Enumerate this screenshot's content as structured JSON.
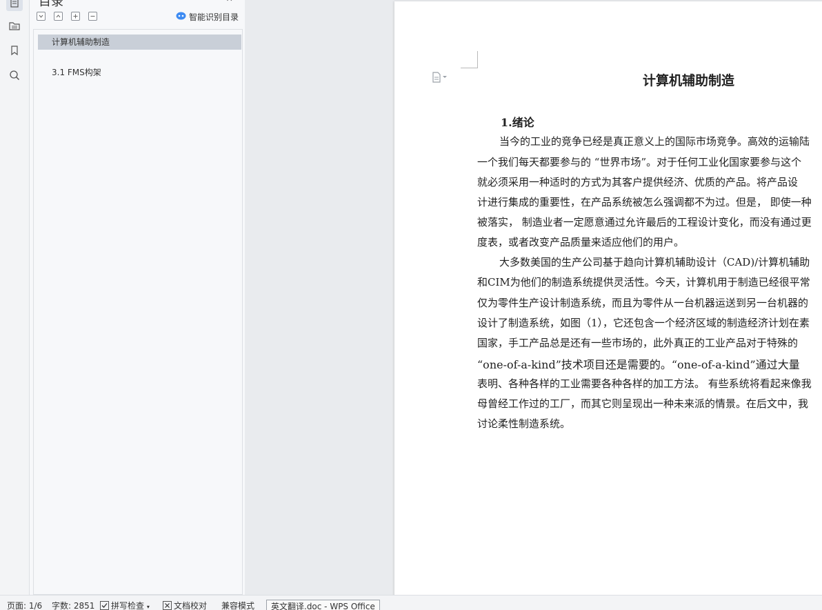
{
  "sidebar": {
    "icons": [
      "document-icon",
      "toc-folder-icon",
      "bookmark-icon",
      "search-icon"
    ]
  },
  "toc": {
    "title": "目录",
    "close_glyph": "×",
    "toolbar": [
      "collapse-all",
      "expand-all",
      "add-level",
      "remove-level"
    ],
    "smart_label": "智能识别目录",
    "items": [
      {
        "label": "计算机辅助制造",
        "selected": true
      },
      {
        "label": "3.1 FMS构架",
        "selected": false
      }
    ]
  },
  "document": {
    "title": "计算机辅助制造",
    "heading": "1.绪论",
    "lines": [
      "当今的工业的竞争已经是真正意义上的国际市场竞争。高效的运输陆",
      "一个我们每天都要参与的 “世界市场”。对于任何工业化国家要参与这个",
      "就必须采用一种适时的方式为其客户提供经济、优质的产品。将产品设",
      "计进行集成的重要性，在产品系统被怎么强调都不为过。但是， 即使一种",
      "被落实， 制造业者一定愿意通过允许最后的工程设计变化，而没有通过更",
      "度表，或者改变产品质量来适应他们的用户。",
      "大多数美国的生产公司基于趋向计算机辅助设计（CAD)/计算机辅助",
      "和CIM为他们的制造系统提供灵活性。今天，计算机用于制造已经很平常",
      "仅为零件生产设计制造系统，而且为零件从一台机器运送到另一台机器的",
      "设计了制造系统，如图（1），它还包含一个经济区域的制造经济计划在素",
      "国家，手工产品总是还有一些市场的，此外真正的工业产品对于特殊的",
      "“one-of-a-kind”技术项目还是需要的。“one-of-a-kind”通过大量",
      "表明、各种各样的工业需要各种各样的加工方法。 有些系统将看起来像我",
      "母曾经工作过的工厂，而其它则呈现出一种未来派的情景。在后文中，我",
      "讨论柔性制造系统。"
    ]
  },
  "status": {
    "page": "页面: 1/6",
    "words": "字数: 2851",
    "spell": "拼写检查",
    "proof": "文档校对",
    "compat": "兼容模式",
    "taskbar": "英文翻译.doc - WPS Office"
  }
}
